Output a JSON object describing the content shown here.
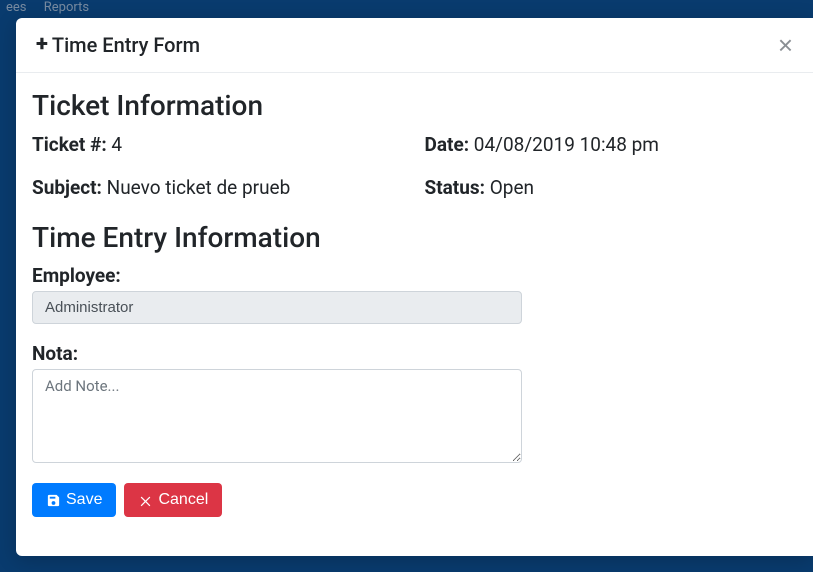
{
  "navbar": {
    "items": [
      "ees",
      "Reports"
    ]
  },
  "modal": {
    "title": "Time Entry Form"
  },
  "sections": {
    "ticket_info_heading": "Ticket Information",
    "time_entry_heading": "Time Entry Information"
  },
  "ticket": {
    "number_label": "Ticket #:",
    "number_value": "4",
    "date_label": "Date:",
    "date_value": "04/08/2019 10:48 pm",
    "subject_label": "Subject:",
    "subject_value": "Nuevo ticket de prueb",
    "status_label": "Status:",
    "status_value": "Open"
  },
  "form": {
    "employee_label": "Employee:",
    "employee_value": "Administrator",
    "note_label": "Nota:",
    "note_placeholder": "Add Note..."
  },
  "buttons": {
    "save": "Save",
    "cancel": "Cancel"
  }
}
